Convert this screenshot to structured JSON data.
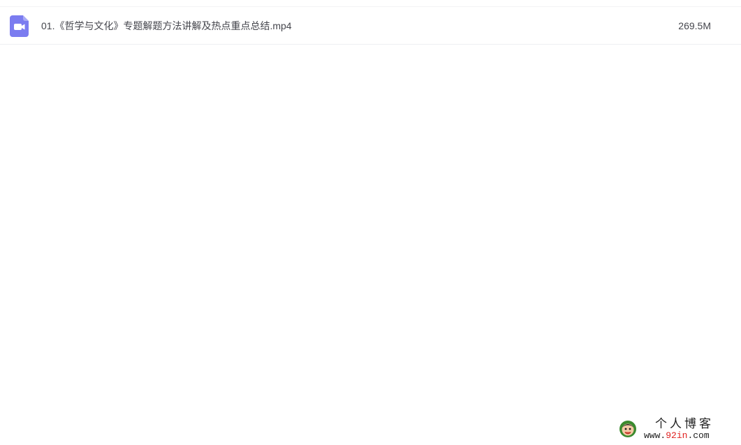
{
  "file_list": {
    "items": [
      {
        "icon": "video-file-icon",
        "name": "01.《哲学与文化》专题解题方法讲解及热点重点总结.mp4",
        "size": "269.5M"
      }
    ]
  },
  "watermark": {
    "title": "个人博客",
    "url_prefix": "www.",
    "url_highlight": "92in",
    "url_suffix": ".com"
  },
  "colors": {
    "icon_accent": "#7b7cf0",
    "text": "#45464d",
    "watermark_highlight": "#e0201f"
  }
}
